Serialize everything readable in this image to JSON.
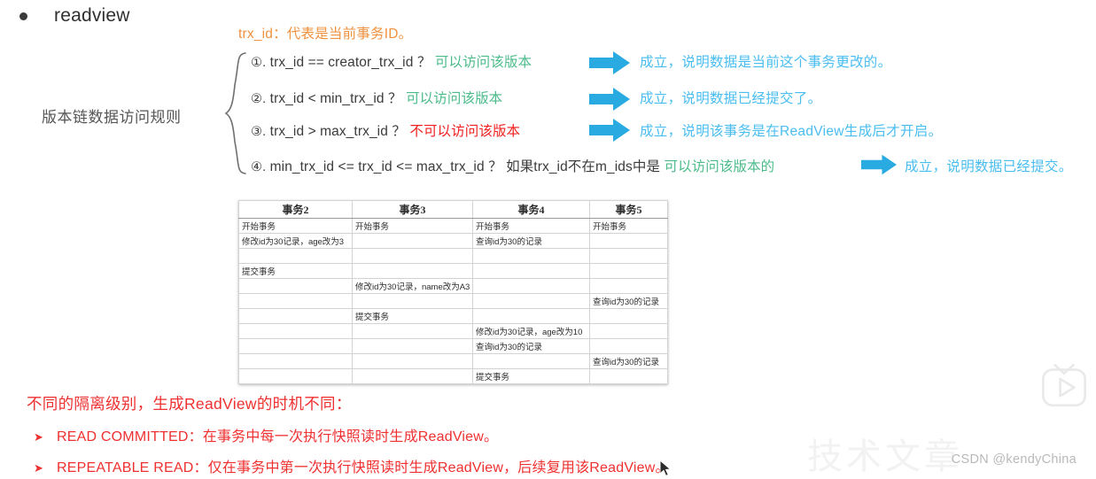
{
  "heading": {
    "bullet": "●",
    "title": "readview"
  },
  "caption": {
    "trx_id_note": "trx_id：代表是当前事务ID。"
  },
  "left_label": "版本链数据访问规则",
  "rules": [
    {
      "num": "①.",
      "cond": "trx_id  == creator_trx_id ？",
      "verdict": "可以访问该版本",
      "verdict_color": "green",
      "result": "成立，说明数据是当前这个事务更改的。"
    },
    {
      "num": "②.",
      "cond": "trx_id < min_trx_id ？",
      "verdict": "可以访问该版本",
      "verdict_color": "green",
      "result": "成立，说明数据已经提交了。"
    },
    {
      "num": "③.",
      "cond": "trx_id > max_trx_id ？",
      "verdict": "不可以访问该版本",
      "verdict_color": "red",
      "result": "成立，说明该事务是在ReadView生成后才开启。"
    },
    {
      "num": "④.",
      "cond": "min_trx_id <= trx_id <= max_trx_id ？ 如果trx_id不在m_ids中是",
      "verdict": "可以访问该版本的",
      "verdict_color": "green",
      "result": "成立，说明数据已经提交。"
    }
  ],
  "table": {
    "headers": [
      "事务2",
      "事务3",
      "事务4",
      "事务5"
    ],
    "rows": [
      [
        "开始事务",
        "开始事务",
        "开始事务",
        "开始事务"
      ],
      [
        "修改id为30记录，age改为3",
        "",
        "查询id为30的记录",
        ""
      ],
      [
        "",
        "",
        "",
        ""
      ],
      [
        "提交事务",
        "",
        "",
        ""
      ],
      [
        "",
        "修改id为30记录，name改为A3",
        "",
        ""
      ],
      [
        "",
        "",
        "",
        "查询id为30的记录"
      ],
      [
        "",
        "提交事务",
        "",
        ""
      ],
      [
        "",
        "",
        "修改id为30记录，age改为10",
        ""
      ],
      [
        "",
        "",
        "查询id为30的记录",
        ""
      ],
      [
        "",
        "",
        "",
        "查询id为30的记录"
      ],
      [
        "",
        "",
        "提交事务",
        ""
      ]
    ]
  },
  "bottom": {
    "title": "不同的隔离级别，生成ReadView的时机不同：",
    "items": [
      {
        "marker": "➤",
        "text": "READ COMMITTED：在事务中每一次执行快照读时生成ReadView。"
      },
      {
        "marker": "➤",
        "text": "REPEATABLE READ：仅在事务中第一次执行快照读时生成ReadView，后续复用该ReadView。"
      }
    ]
  },
  "watermark": {
    "text": "CSDN @kendyChina",
    "ghost": "技术文章"
  },
  "colors": {
    "accent_blue": "#29ABE2",
    "result_blue": "#49BDF0",
    "green": "#4CBB8A",
    "red": "#F01F1F",
    "orange": "#F0913E",
    "heading_gray": "#2F2F2F"
  }
}
